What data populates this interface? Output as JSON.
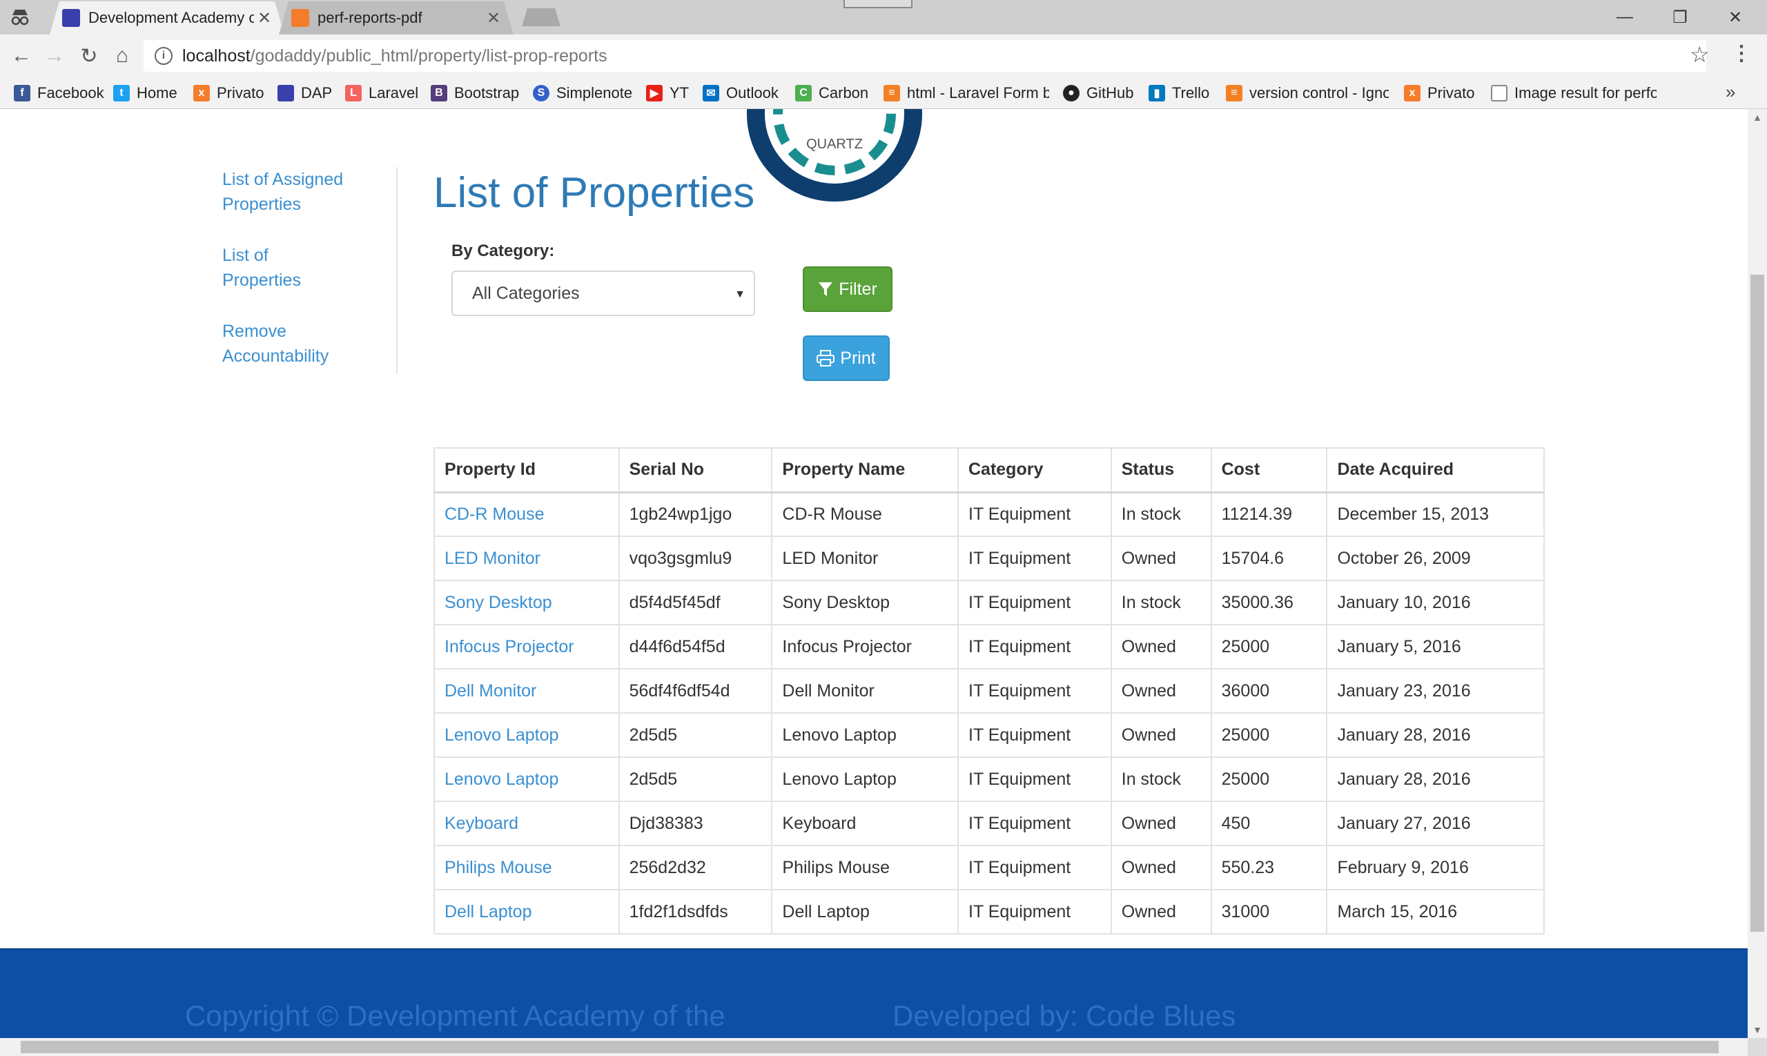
{
  "browser": {
    "tabs": [
      {
        "title": "Development Academy of the",
        "active": true
      },
      {
        "title": "perf-reports-pdf",
        "active": false
      }
    ],
    "url_host": "localhost",
    "url_path": "/godaddy/public_html/property/list-prop-reports",
    "bookmarks": [
      {
        "label": "Facebook",
        "icon": "facebook-icon",
        "color": "#3b5998"
      },
      {
        "label": "Home",
        "icon": "twitter-icon",
        "color": "#1da1f2"
      },
      {
        "label": "Privato",
        "icon": "xampp-icon",
        "color": "#f57c2b"
      },
      {
        "label": "DAP",
        "icon": "dap-icon",
        "color": "#3a3fae"
      },
      {
        "label": "Laravel",
        "icon": "laravel-icon",
        "color": "#f4645f"
      },
      {
        "label": "Bootstrap",
        "icon": "bootstrap-icon",
        "color": "#563d7c"
      },
      {
        "label": "Simplenote",
        "icon": "simplenote-icon",
        "color": "#3361cc"
      },
      {
        "label": "YT",
        "icon": "youtube-icon",
        "color": "#e62117"
      },
      {
        "label": "Outlook",
        "icon": "outlook-icon",
        "color": "#0072c6"
      },
      {
        "label": "Carbon",
        "icon": "carbon-icon",
        "color": "#4caf50"
      },
      {
        "label": "html - Laravel Form b",
        "icon": "stackoverflow-icon",
        "color": "#f48024"
      },
      {
        "label": "GitHub",
        "icon": "github-icon",
        "color": "#222222"
      },
      {
        "label": "Trello",
        "icon": "trello-icon",
        "color": "#0079bf"
      },
      {
        "label": "version control - Igno",
        "icon": "stackoverflow-icon",
        "color": "#f48024"
      },
      {
        "label": "Privato",
        "icon": "xampp-icon",
        "color": "#f57c2b"
      },
      {
        "label": "Image result for perfo",
        "icon": "document-icon",
        "color": "#888888"
      }
    ]
  },
  "logo": {
    "text": "QUARTZ"
  },
  "sidebar": {
    "items": [
      {
        "label": "List of Assigned Properties"
      },
      {
        "label": "List of Properties"
      },
      {
        "label": "Remove Accountability"
      }
    ]
  },
  "main": {
    "title": "List of Properties",
    "filter_label": "By Category:",
    "category_selected": "All Categories",
    "filter_button": "Filter",
    "print_button": "Print"
  },
  "table": {
    "headers": [
      "Property Id",
      "Serial No",
      "Property Name",
      "Category",
      "Status",
      "Cost",
      "Date Acquired"
    ],
    "rows": [
      [
        "CD-R Mouse",
        "1gb24wp1jgo",
        "CD-R Mouse",
        "IT Equipment",
        "In stock",
        "11214.39",
        "December 15, 2013"
      ],
      [
        "LED Monitor",
        "vqo3gsgmlu9",
        "LED Monitor",
        "IT Equipment",
        "Owned",
        "15704.6",
        "October 26, 2009"
      ],
      [
        "Sony Desktop",
        "d5f4d5f45df",
        "Sony Desktop",
        "IT Equipment",
        "In stock",
        "35000.36",
        "January 10, 2016"
      ],
      [
        "Infocus Projector",
        "d44f6d54f5d",
        "Infocus Projector",
        "IT Equipment",
        "Owned",
        "25000",
        "January 5, 2016"
      ],
      [
        "Dell Monitor",
        "56df4f6df54d",
        "Dell Monitor",
        "IT Equipment",
        "Owned",
        "36000",
        "January 23, 2016"
      ],
      [
        "Lenovo Laptop",
        "2d5d5",
        "Lenovo Laptop",
        "IT Equipment",
        "Owned",
        "25000",
        "January 28, 2016"
      ],
      [
        "Lenovo Laptop",
        "2d5d5",
        "Lenovo Laptop",
        "IT Equipment",
        "In stock",
        "25000",
        "January 28, 2016"
      ],
      [
        "Keyboard",
        "Djd38383",
        "Keyboard",
        "IT Equipment",
        "Owned",
        "450",
        "January 27, 2016"
      ],
      [
        "Philips Mouse",
        "256d2d32",
        "Philips Mouse",
        "IT Equipment",
        "Owned",
        "550.23",
        "February 9, 2016"
      ],
      [
        "Dell Laptop",
        "1fd2f1dsdfds",
        "Dell Laptop",
        "IT Equipment",
        "Owned",
        "31000",
        "March 15, 2016"
      ]
    ]
  },
  "footer": {
    "copyright": "Copyright © Development Academy of the",
    "developer": "Developed by: Code Blues"
  }
}
